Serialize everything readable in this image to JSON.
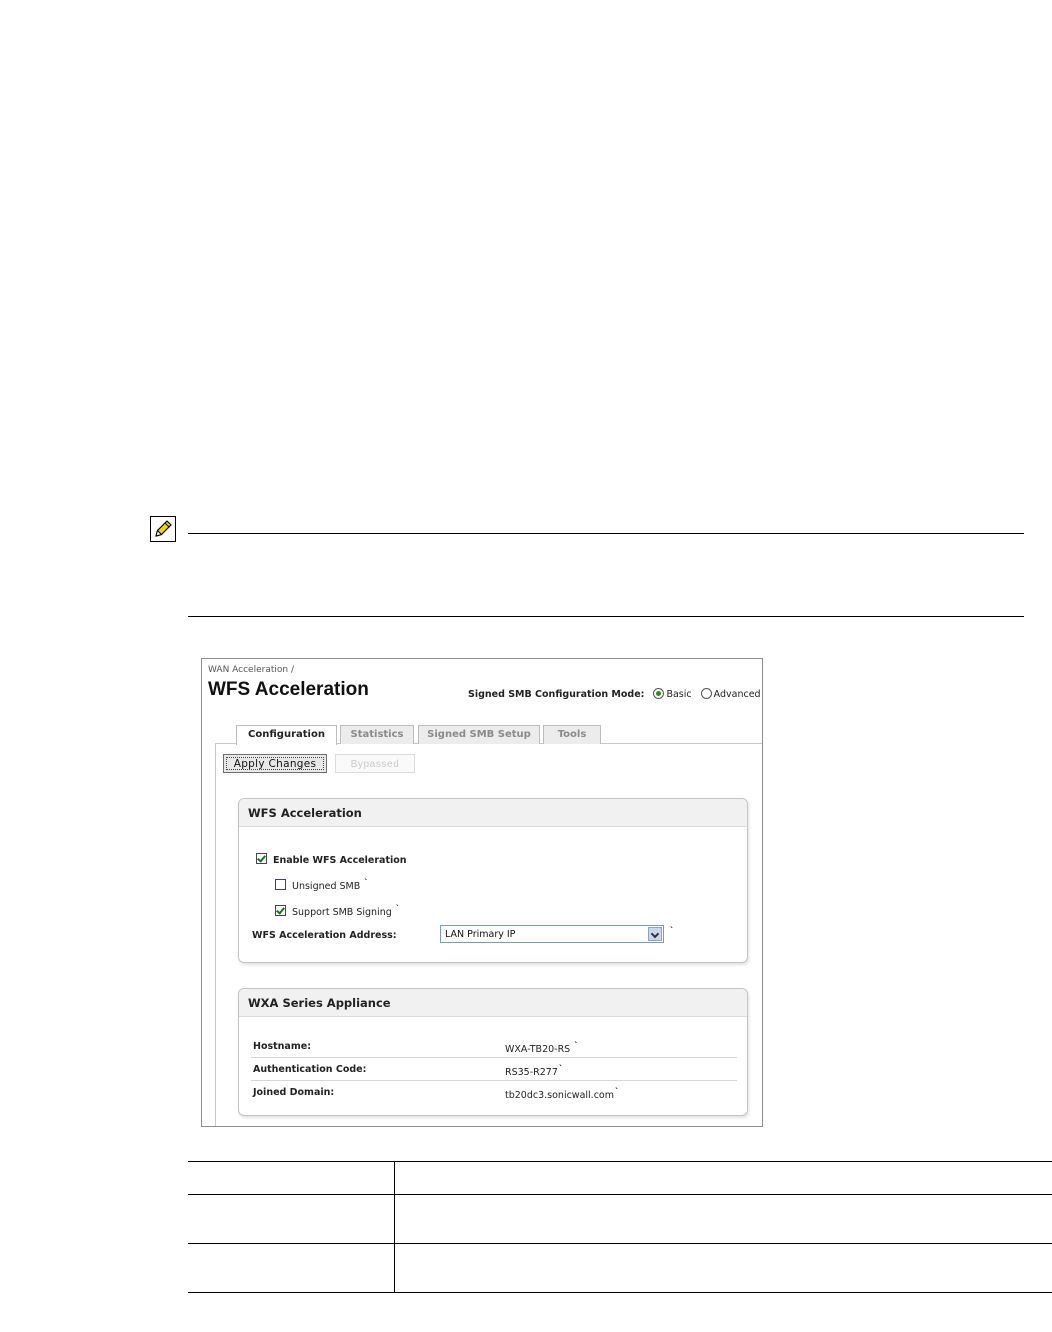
{
  "icons": {
    "note": "pencil-icon",
    "dropdown": "chevron-down-icon"
  },
  "screen": {
    "breadcrumb": "WAN Acceleration /",
    "title": "WFS Acceleration",
    "mode_label": "Signed SMB Configuration Mode:",
    "mode_options": [
      {
        "label": "Basic",
        "selected": true
      },
      {
        "label": "Advanced",
        "selected": false
      }
    ],
    "tabs": [
      "Configuration",
      "Statistics",
      "Signed SMB Setup",
      "Tools"
    ],
    "active_tab": "Configuration",
    "buttons": {
      "apply": "Apply Changes",
      "bypassed": "Bypassed"
    },
    "wfs_section": {
      "heading": "WFS Acceleration",
      "enable_label": "Enable WFS Acceleration",
      "enable_checked": true,
      "unsigned_label": "Unsigned SMB",
      "unsigned_checked": false,
      "signing_label": "Support SMB Signing",
      "signing_checked": true,
      "address_label": "WFS Acceleration Address:",
      "address_value": "LAN Primary IP"
    },
    "wxa_section": {
      "heading": "WXA Series Appliance",
      "rows": [
        {
          "label": "Hostname:",
          "value": "WXA-TB20-RS"
        },
        {
          "label": "Authentication Code:",
          "value": "RS35-R277"
        },
        {
          "label": "Joined Domain:",
          "value": "tb20dc3.sonicwall.com"
        }
      ]
    }
  }
}
